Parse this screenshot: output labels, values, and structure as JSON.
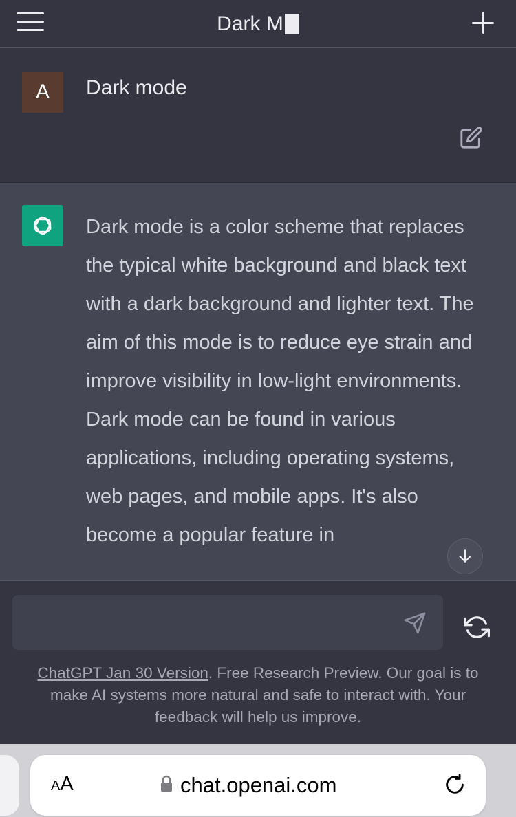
{
  "header": {
    "title": "Dark M",
    "menu_icon": "hamburger-menu-icon",
    "new_chat_icon": "plus-icon"
  },
  "user_message": {
    "avatar_letter": "A",
    "text": "Dark mode",
    "avatar_color": "#5a3b2f"
  },
  "assistant_message": {
    "avatar_icon": "openai-logo-icon",
    "avatar_color": "#10a37f",
    "text": "Dark mode is a color scheme that replaces the typical white background and black text with a dark background and lighter text. The aim of this mode is to reduce eye strain and improve visibility in low-light environments. Dark mode can be found in various applications, including operating systems, web pages, and mobile apps. It's also become a popular feature in"
  },
  "composer": {
    "input_value": "",
    "send_icon": "paper-plane-icon",
    "regenerate_icon": "refresh-arrows-icon"
  },
  "footer": {
    "version_link": "ChatGPT Jan 30 Version",
    "note": ". Free Research Preview. Our goal is to make AI systems more natural and safe to interact with. Your feedback will help us improve."
  },
  "browser": {
    "aa_small": "A",
    "aa_big": "A",
    "url": "chat.openai.com",
    "lock_icon": "lock-icon",
    "reload_icon": "reload-icon"
  },
  "colors": {
    "background": "#343541",
    "assistant_background": "#444654",
    "accent": "#10a37f"
  }
}
